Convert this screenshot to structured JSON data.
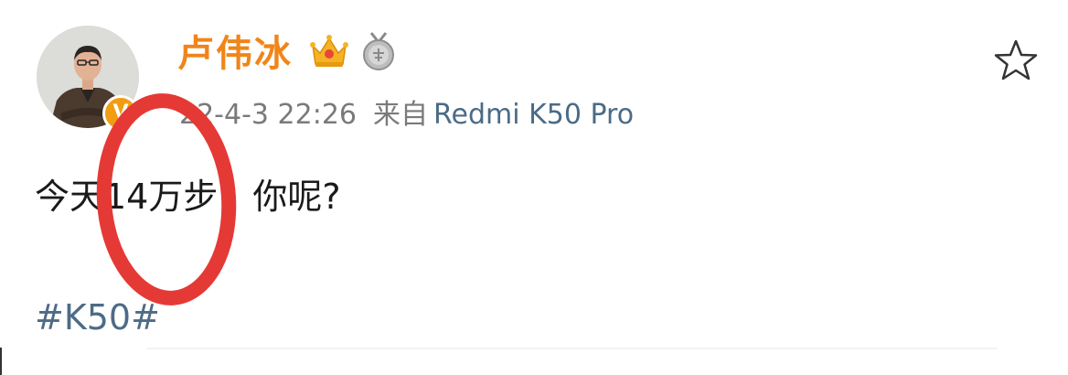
{
  "post": {
    "author": {
      "name": "卢伟冰",
      "verified_badge": "V",
      "badges": [
        "crown-icon",
        "medal-icon"
      ]
    },
    "timestamp": "22-4-3 22:26",
    "source_label": "来自",
    "source_device": "Redmi K50 Pro",
    "content": "今天14万步，你呢?",
    "hashtag": "#K50#"
  },
  "colors": {
    "username": "#f08519",
    "hashtag": "#4e6b86",
    "source": "#4a6b87",
    "annotation": "#e53935",
    "verified": "#f29d11"
  }
}
